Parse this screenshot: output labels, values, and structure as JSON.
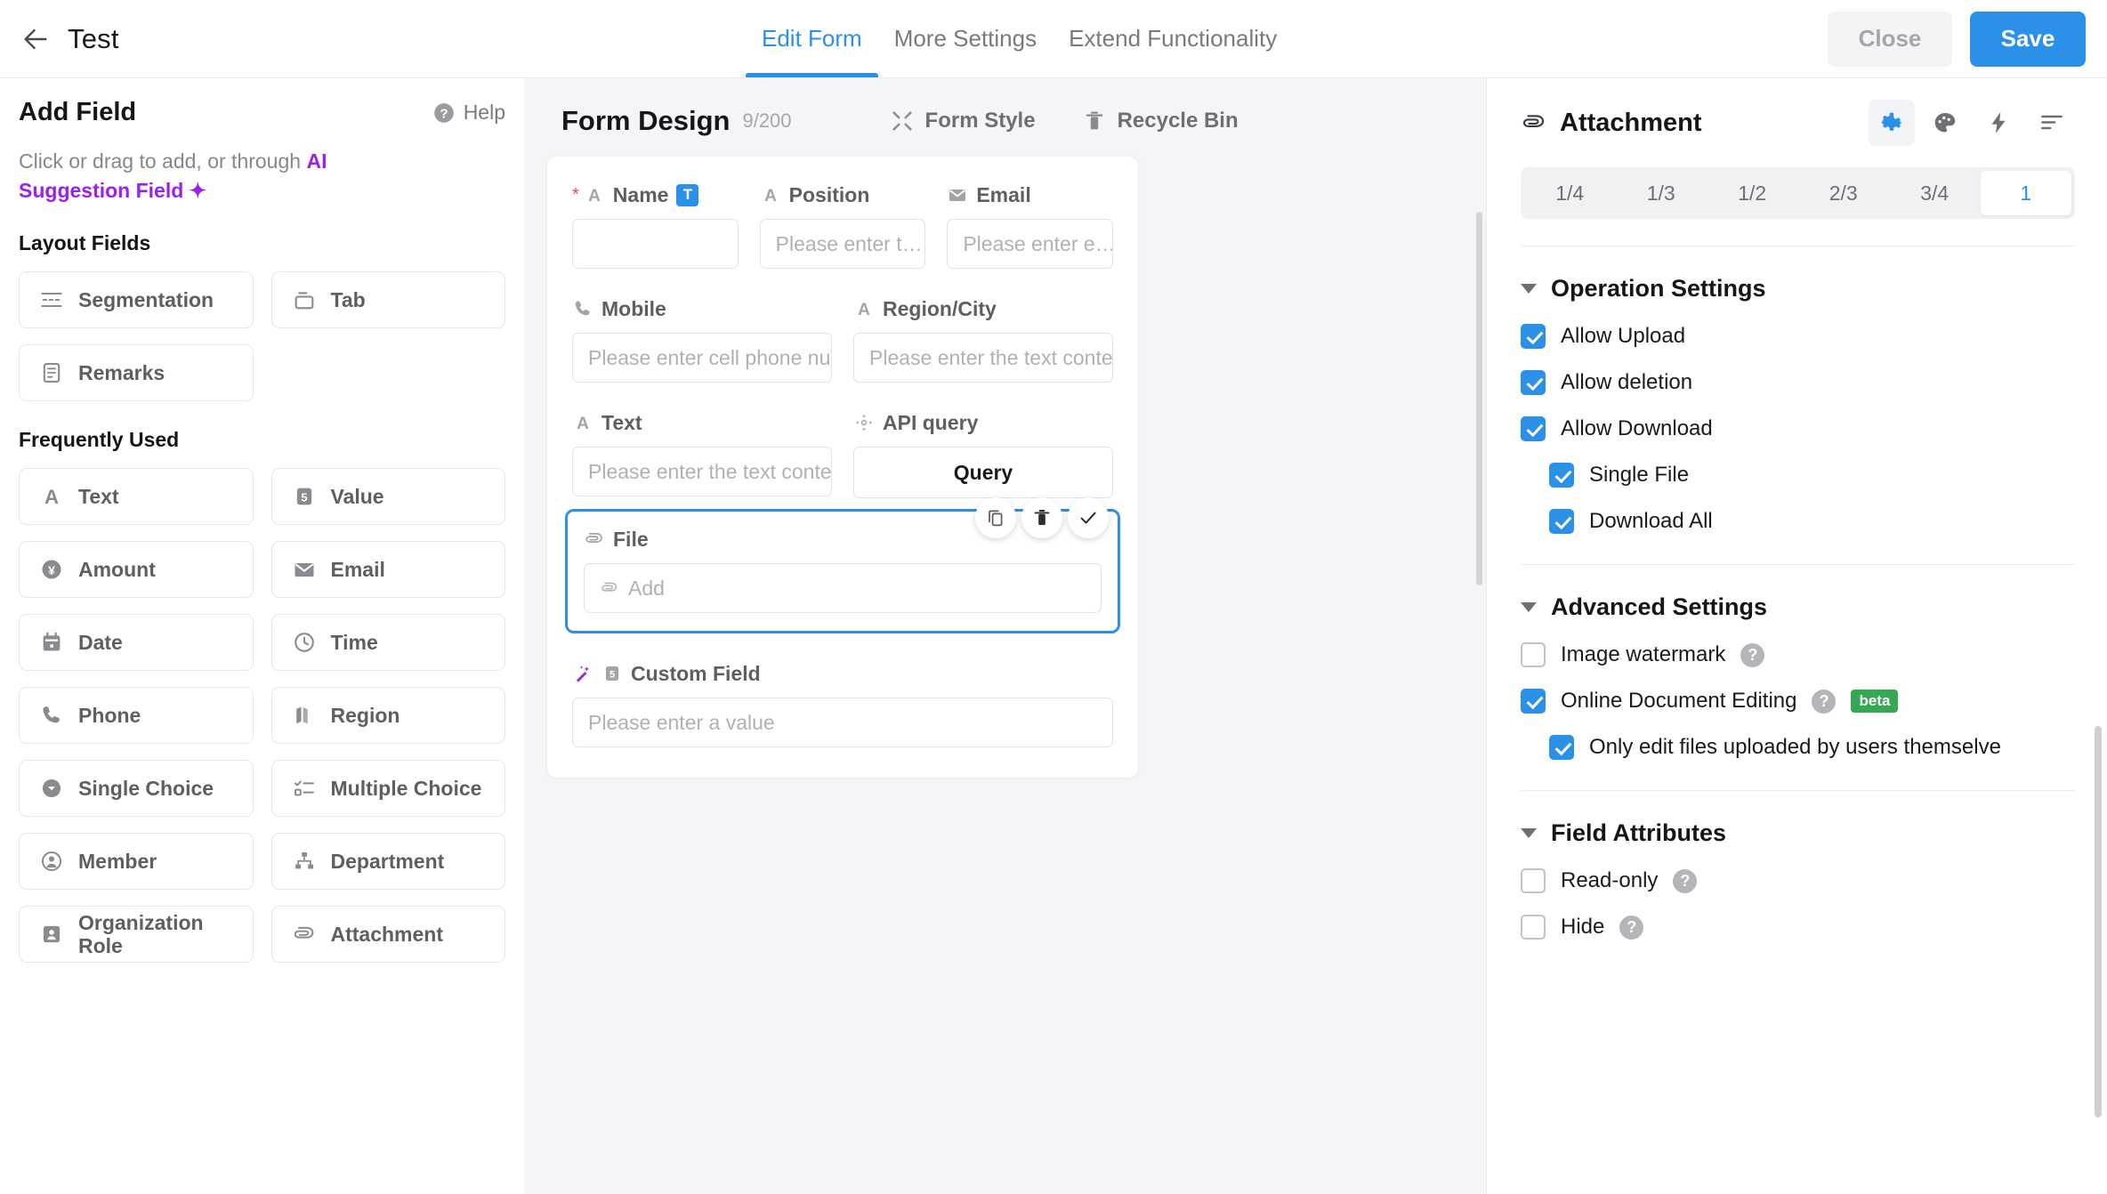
{
  "topbar": {
    "back_icon": "arrow-left-icon",
    "title": "Test",
    "tabs": [
      {
        "label": "Edit Form",
        "active": true
      },
      {
        "label": "More Settings",
        "active": false
      },
      {
        "label": "Extend Functionality",
        "active": false
      }
    ],
    "close_label": "Close",
    "save_label": "Save"
  },
  "sidebar": {
    "title": "Add Field",
    "help_label": "Help",
    "hint_prefix": "Click or drag to add, or through ",
    "hint_ai": "AI Suggestion Field",
    "groups": [
      {
        "title": "Layout Fields",
        "items": [
          {
            "label": "Segmentation",
            "icon": "segmentation-icon"
          },
          {
            "label": "Tab",
            "icon": "tab-icon"
          },
          {
            "label": "Remarks",
            "icon": "remarks-icon"
          }
        ]
      },
      {
        "title": "Frequently Used",
        "items": [
          {
            "label": "Text",
            "icon": "text-a-icon"
          },
          {
            "label": "Value",
            "icon": "number-icon"
          },
          {
            "label": "Amount",
            "icon": "amount-yen-icon"
          },
          {
            "label": "Email",
            "icon": "envelope-icon"
          },
          {
            "label": "Date",
            "icon": "calendar-icon"
          },
          {
            "label": "Time",
            "icon": "clock-icon"
          },
          {
            "label": "Phone",
            "icon": "phone-icon"
          },
          {
            "label": "Region",
            "icon": "map-icon"
          },
          {
            "label": "Single Choice",
            "icon": "single-choice-icon"
          },
          {
            "label": "Multiple Choice",
            "icon": "multiple-choice-icon"
          },
          {
            "label": "Member",
            "icon": "member-icon"
          },
          {
            "label": "Department",
            "icon": "department-icon"
          },
          {
            "label": "Organization Role",
            "icon": "organization-role-icon"
          },
          {
            "label": "Attachment",
            "icon": "paperclip-icon"
          }
        ]
      }
    ]
  },
  "canvas": {
    "title": "Form Design",
    "count": "9/200",
    "tools": [
      {
        "label": "Form Style",
        "icon": "form-style-icon"
      },
      {
        "label": "Recycle Bin",
        "icon": "trash-icon"
      }
    ],
    "rows": [
      {
        "fields": [
          {
            "label": "Name",
            "icon": "text-a-icon",
            "required": true,
            "badge": "T",
            "placeholder": ""
          },
          {
            "label": "Position",
            "icon": "text-a-icon",
            "required": false,
            "placeholder": "Please enter t…"
          },
          {
            "label": "Email",
            "icon": "envelope-icon",
            "required": false,
            "placeholder": "Please enter e…"
          }
        ]
      },
      {
        "fields": [
          {
            "label": "Mobile",
            "icon": "phone-icon",
            "required": false,
            "placeholder": "Please enter cell phone nu…"
          },
          {
            "label": "Region/City",
            "icon": "text-a-icon",
            "required": false,
            "placeholder": "Please enter the text content"
          }
        ]
      },
      {
        "fields": [
          {
            "label": "Text",
            "icon": "text-a-icon",
            "required": false,
            "placeholder": "Please enter the text content"
          },
          {
            "label": "API query",
            "icon": "api-query-icon",
            "required": false,
            "button_label": "Query"
          }
        ]
      }
    ],
    "selected_field": {
      "label": "File",
      "icon": "paperclip-icon",
      "add_placeholder": "Add",
      "actions": [
        {
          "name": "copy-icon"
        },
        {
          "name": "delete-icon"
        },
        {
          "name": "confirm-icon"
        }
      ]
    },
    "custom_field": {
      "label": "Custom Field",
      "icon": "magic-wand-icon",
      "badge_icon": "number-icon",
      "placeholder": "Please enter a value"
    }
  },
  "properties": {
    "title": "Attachment",
    "title_icon": "paperclip-icon",
    "header_icons": [
      {
        "name": "gear-icon",
        "active": true
      },
      {
        "name": "palette-icon",
        "active": false
      },
      {
        "name": "lightning-icon",
        "active": false
      },
      {
        "name": "align-left-icon",
        "active": false
      }
    ],
    "width_options": [
      "1/4",
      "1/3",
      "1/2",
      "2/3",
      "3/4",
      "1"
    ],
    "width_selected": "1",
    "sections": [
      {
        "title": "Operation Settings",
        "rows": [
          {
            "label": "Allow Upload",
            "checked": true,
            "indent": false
          },
          {
            "label": "Allow deletion",
            "checked": true,
            "indent": false
          },
          {
            "label": "Allow Download",
            "checked": true,
            "indent": false
          },
          {
            "label": "Single File",
            "checked": true,
            "indent": true
          },
          {
            "label": "Download All",
            "checked": true,
            "indent": true
          }
        ]
      },
      {
        "title": "Advanced Settings",
        "rows": [
          {
            "label": "Image watermark",
            "checked": false,
            "indent": false,
            "help": true
          },
          {
            "label": "Online Document Editing",
            "checked": true,
            "indent": false,
            "help": true,
            "badge": "beta"
          },
          {
            "label": "Only edit files uploaded by users themselve",
            "checked": true,
            "indent": true
          }
        ]
      },
      {
        "title": "Field Attributes",
        "rows": [
          {
            "label": "Read-only",
            "checked": false,
            "indent": false,
            "help": true
          },
          {
            "label": "Hide",
            "checked": false,
            "indent": false,
            "help": true
          }
        ]
      }
    ]
  },
  "colors": {
    "accent": "#2a90e8",
    "ai_purple": "#9a1ff0",
    "beta_green": "#34a853",
    "required_red": "#f04b3c"
  }
}
